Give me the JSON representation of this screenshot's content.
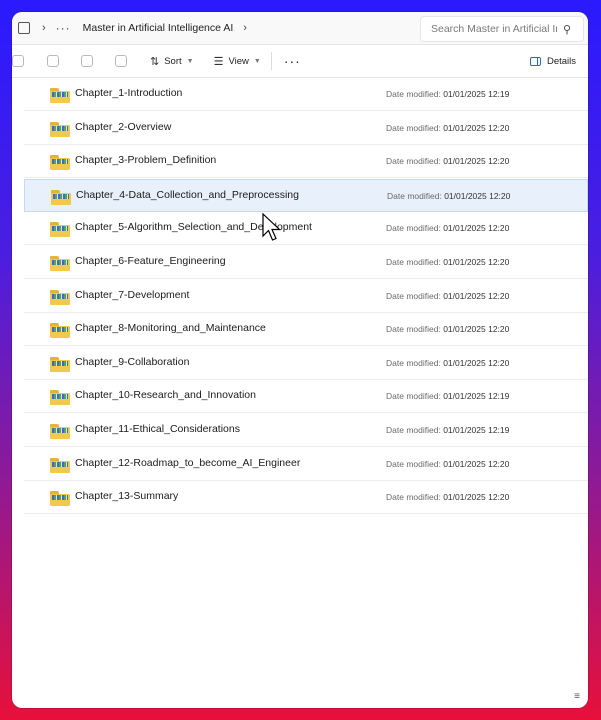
{
  "address": {
    "path_label": "Master in Artificial Intelligence AI",
    "search_placeholder": "Search Master in Artificial In"
  },
  "toolbar": {
    "sort_label": "Sort",
    "view_label": "View",
    "more_label": "···",
    "details_label": "Details"
  },
  "list": {
    "date_label": "Date modified:",
    "items": [
      {
        "name": "Chapter_1-Introduction",
        "date": "01/01/2025 12:19"
      },
      {
        "name": "Chapter_2-Overview",
        "date": "01/01/2025 12:20"
      },
      {
        "name": "Chapter_3-Problem_Definition",
        "date": "01/01/2025 12:20"
      },
      {
        "name": "Chapter_4-Data_Collection_and_Preprocessing",
        "date": "01/01/2025 12:20"
      },
      {
        "name": "Chapter_5-Algorithm_Selection_and_Development",
        "date": "01/01/2025 12:20"
      },
      {
        "name": "Chapter_6-Feature_Engineering",
        "date": "01/01/2025 12:20"
      },
      {
        "name": "Chapter_7-Development",
        "date": "01/01/2025 12:20"
      },
      {
        "name": "Chapter_8-Monitoring_and_Maintenance",
        "date": "01/01/2025 12:20"
      },
      {
        "name": "Chapter_9-Collaboration",
        "date": "01/01/2025 12:20"
      },
      {
        "name": "Chapter_10-Research_and_Innovation",
        "date": "01/01/2025 12:19"
      },
      {
        "name": "Chapter_11-Ethical_Considerations",
        "date": "01/01/2025 12:19"
      },
      {
        "name": "Chapter_12-Roadmap_to_become_AI_Engineer",
        "date": "01/01/2025 12:20"
      },
      {
        "name": "Chapter_13-Summary",
        "date": "01/01/2025 12:20"
      }
    ]
  },
  "colors": {
    "accent": "#1a6fc0",
    "selection": "#e8f1fb",
    "folder": "#f2c94c"
  }
}
